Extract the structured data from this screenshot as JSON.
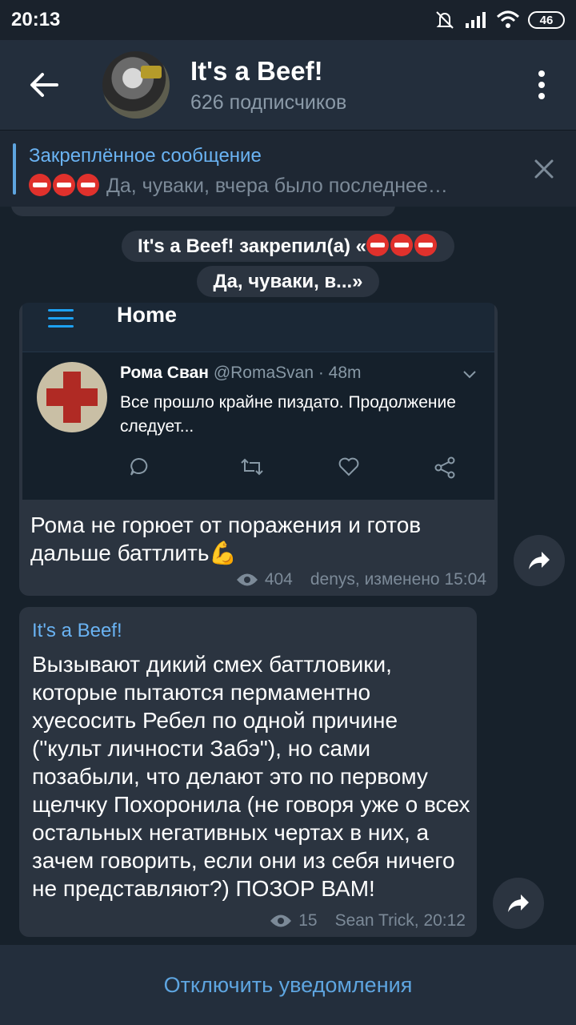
{
  "status_bar": {
    "time": "20:13",
    "battery": "46"
  },
  "header": {
    "title": "It's a Beef!",
    "subtitle": "626 подписчиков"
  },
  "pinned": {
    "title": "Закреплённое сообщение",
    "text": "Да, чуваки, вчера было последнее…"
  },
  "service_message": {
    "line1": "It's a Beef! закрепил(а) «",
    "line2": "Да, чуваки, в...»"
  },
  "message1": {
    "tweet": {
      "header": "Home",
      "author": "Рома Сван",
      "handle": "@RomaSvan · 48m",
      "text": "Все прошло крайне пиздато. Продолжение следует..."
    },
    "text": "Рома не горюет от поражения и готов дальше баттлить💪",
    "views": "404",
    "signature": "denys, изменено 15:04"
  },
  "message2": {
    "author": "It's a Beef!",
    "text": "Вызывают дикий смех баттловики, которые пытаются пермаментно хуесосить Ребел по одной причине (\"культ личности Забэ\"), но сами позабыли, что делают это по первому щелчку Похоронила (не говоря уже о всех остальных негативных чертах в них, а зачем говорить, если они из себя ничего не представляют?) ПОЗОР ВАМ!",
    "views": "15",
    "signature": "Sean Trick, 20:12"
  },
  "bottom": {
    "label": "Отключить уведомления"
  },
  "colors": {
    "accent": "#6ab3f3",
    "background": "#17212b",
    "bubble": "#2b3440"
  },
  "icons": [
    "back-arrow-icon",
    "more-vert-icon",
    "close-icon",
    "eye-icon",
    "share-icon",
    "stop-sign-emoji"
  ]
}
